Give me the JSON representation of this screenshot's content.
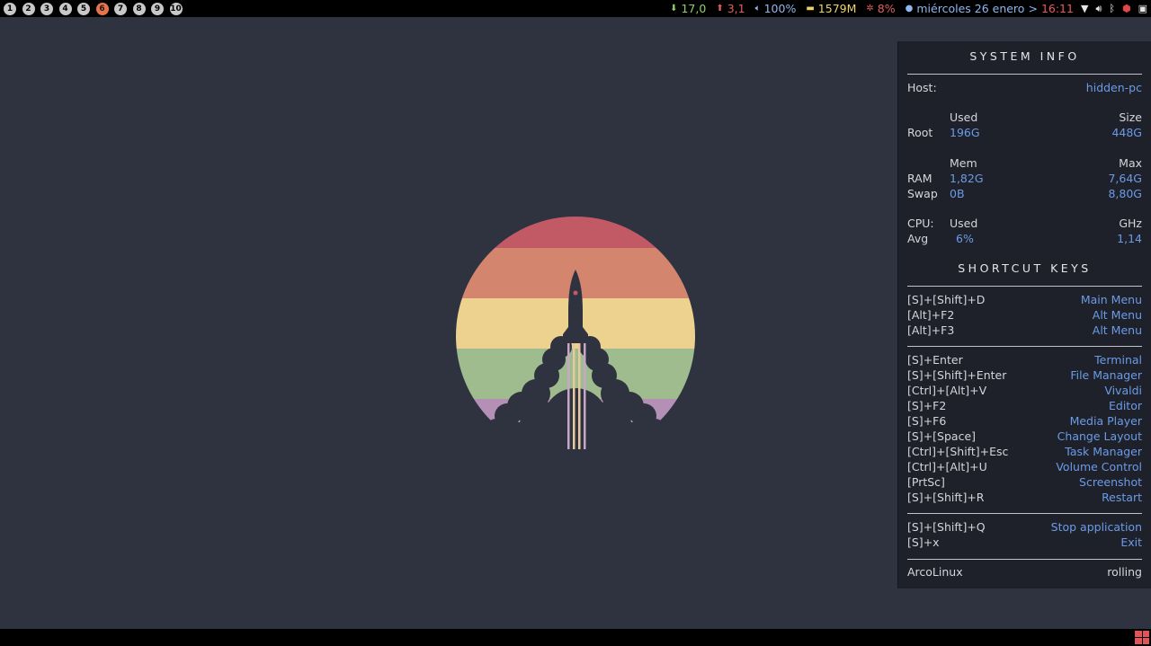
{
  "topbar": {
    "workspaces": [
      "1",
      "2",
      "3",
      "4",
      "5",
      "6",
      "7",
      "8",
      "9",
      "10"
    ],
    "active_workspace": 6,
    "net_down": {
      "icon": "arrow-down-icon",
      "value": "17,0",
      "color": "#8fd26b"
    },
    "net_up": {
      "icon": "arrow-up-icon",
      "value": "3,1",
      "color": "#e06060"
    },
    "volume": {
      "icon": "speaker-icon",
      "value": "100%",
      "color": "#8fb7f0"
    },
    "memory": {
      "icon": "memory-icon",
      "value": "1579M",
      "color": "#f0d26a"
    },
    "cpu": {
      "icon": "cpu-icon",
      "value": "8%",
      "color": "#e06060"
    },
    "date": {
      "icon": "clock-icon",
      "value": "miércoles 26 enero",
      "color": "#8fb7f0"
    },
    "separator": ">",
    "time": {
      "value": "16:11",
      "color": "#e85a5a"
    },
    "tray": [
      "wifi-icon",
      "volume-tray-icon",
      "bluetooth-icon",
      "shield-icon",
      "laptop-icon"
    ]
  },
  "conky": {
    "system_title": "SYSTEM  INFO",
    "host_label": "Host:",
    "host_value": "hidden-pc",
    "root": {
      "col_used": "Used",
      "col_size": "Size",
      "label": "Root",
      "used": "196G",
      "size": "448G"
    },
    "mem": {
      "col_mem": "Mem",
      "col_max": "Max",
      "ram_label": "RAM",
      "ram_used": "1,82G",
      "ram_max": "7,64G",
      "swap_label": "Swap",
      "swap_used": "0B",
      "swap_max": "8,80G"
    },
    "cpu": {
      "label": "CPU:",
      "col_used": "Used",
      "col_ghz": "GHz",
      "avg_label": "Avg",
      "avg_used": "6%",
      "avg_ghz": "1,14"
    },
    "shortcut_title": "SHORTCUT  KEYS",
    "shortcuts_group1": [
      {
        "keys": "[S]+[Shift]+D",
        "action": "Main Menu"
      },
      {
        "keys": "[Alt]+F2",
        "action": "Alt Menu"
      },
      {
        "keys": "[Alt]+F3",
        "action": "Alt Menu"
      }
    ],
    "shortcuts_group2": [
      {
        "keys": "[S]+Enter",
        "action": "Terminal"
      },
      {
        "keys": "[S]+[Shift]+Enter",
        "action": "File Manager"
      },
      {
        "keys": "[Ctrl]+[Alt]+V",
        "action": "Vivaldi"
      },
      {
        "keys": "[S]+F2",
        "action": "Editor"
      },
      {
        "keys": "[S]+F6",
        "action": "Media Player"
      },
      {
        "keys": "[S]+[Space]",
        "action": "Change Layout"
      },
      {
        "keys": "[Ctrl]+[Shift]+Esc",
        "action": "Task Manager"
      },
      {
        "keys": "[Ctrl]+[Alt]+U",
        "action": "Volume Control"
      },
      {
        "keys": "[PrtSc]",
        "action": "Screenshot"
      },
      {
        "keys": "[S]+[Shift]+R",
        "action": "Restart"
      }
    ],
    "shortcuts_group3": [
      {
        "keys": "[S]+[Shift]+Q",
        "action": "Stop application"
      },
      {
        "keys": "[S]+x",
        "action": "Exit"
      }
    ],
    "distro": "ArcoLinux",
    "release": "rolling"
  },
  "wallpaper": {
    "stripe_colors": [
      "#c25a66",
      "#d4856e",
      "#ecd18f",
      "#9fbc8e",
      "#b48fb6"
    ],
    "rocket_color": "#2f3340"
  },
  "bottombar": {
    "layout_icon": "tile-layout-icon",
    "layout_color": "#e0555a"
  }
}
